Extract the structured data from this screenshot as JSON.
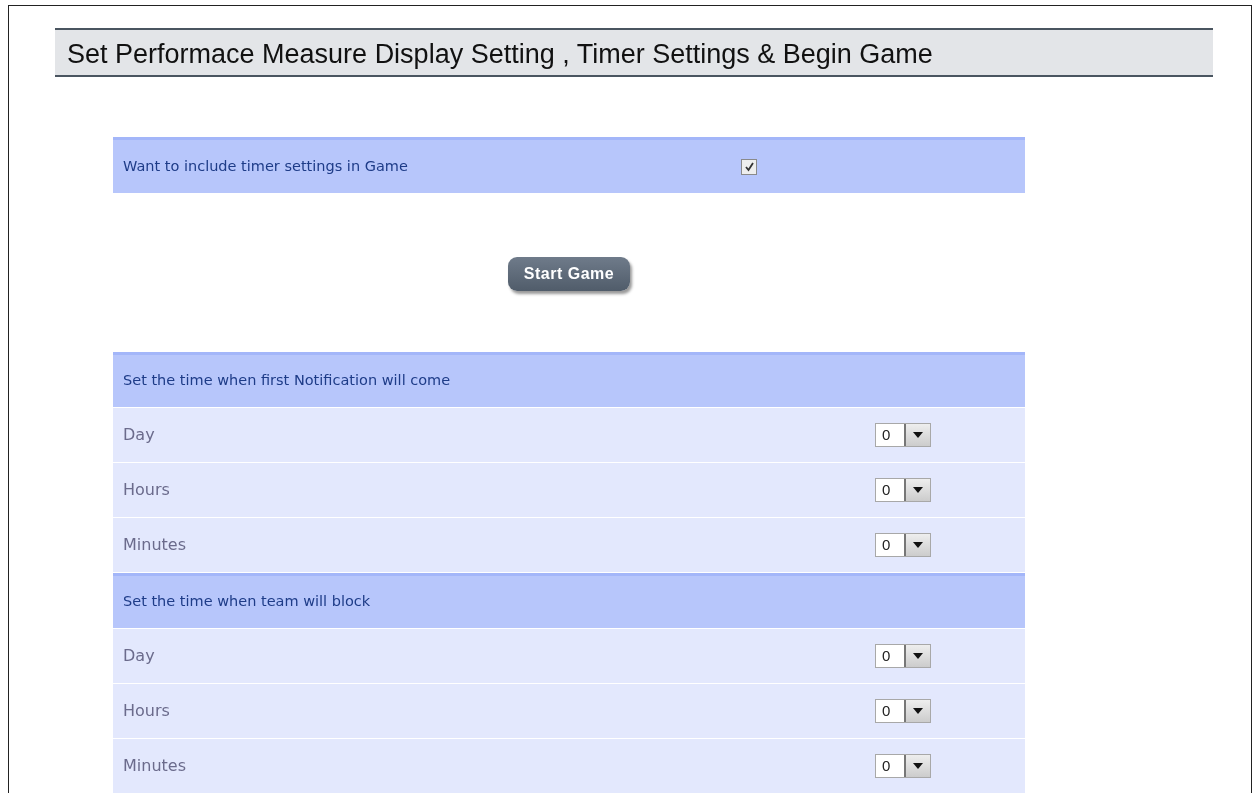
{
  "title": "Set Performace Measure Display Setting , Timer Settings & Begin Game",
  "timer_option": {
    "label": "Want to include timer settings in Game",
    "checked": true
  },
  "start_button": "Start Game",
  "sections": [
    {
      "heading": "Set the time when first Notification will come",
      "fields": [
        {
          "label": "Day",
          "value": "0"
        },
        {
          "label": "Hours",
          "value": "0"
        },
        {
          "label": "Minutes",
          "value": "0"
        }
      ]
    },
    {
      "heading": "Set the time when team will block",
      "fields": [
        {
          "label": "Day",
          "value": "0"
        },
        {
          "label": "Hours",
          "value": "0"
        },
        {
          "label": "Minutes",
          "value": "0"
        }
      ]
    }
  ]
}
